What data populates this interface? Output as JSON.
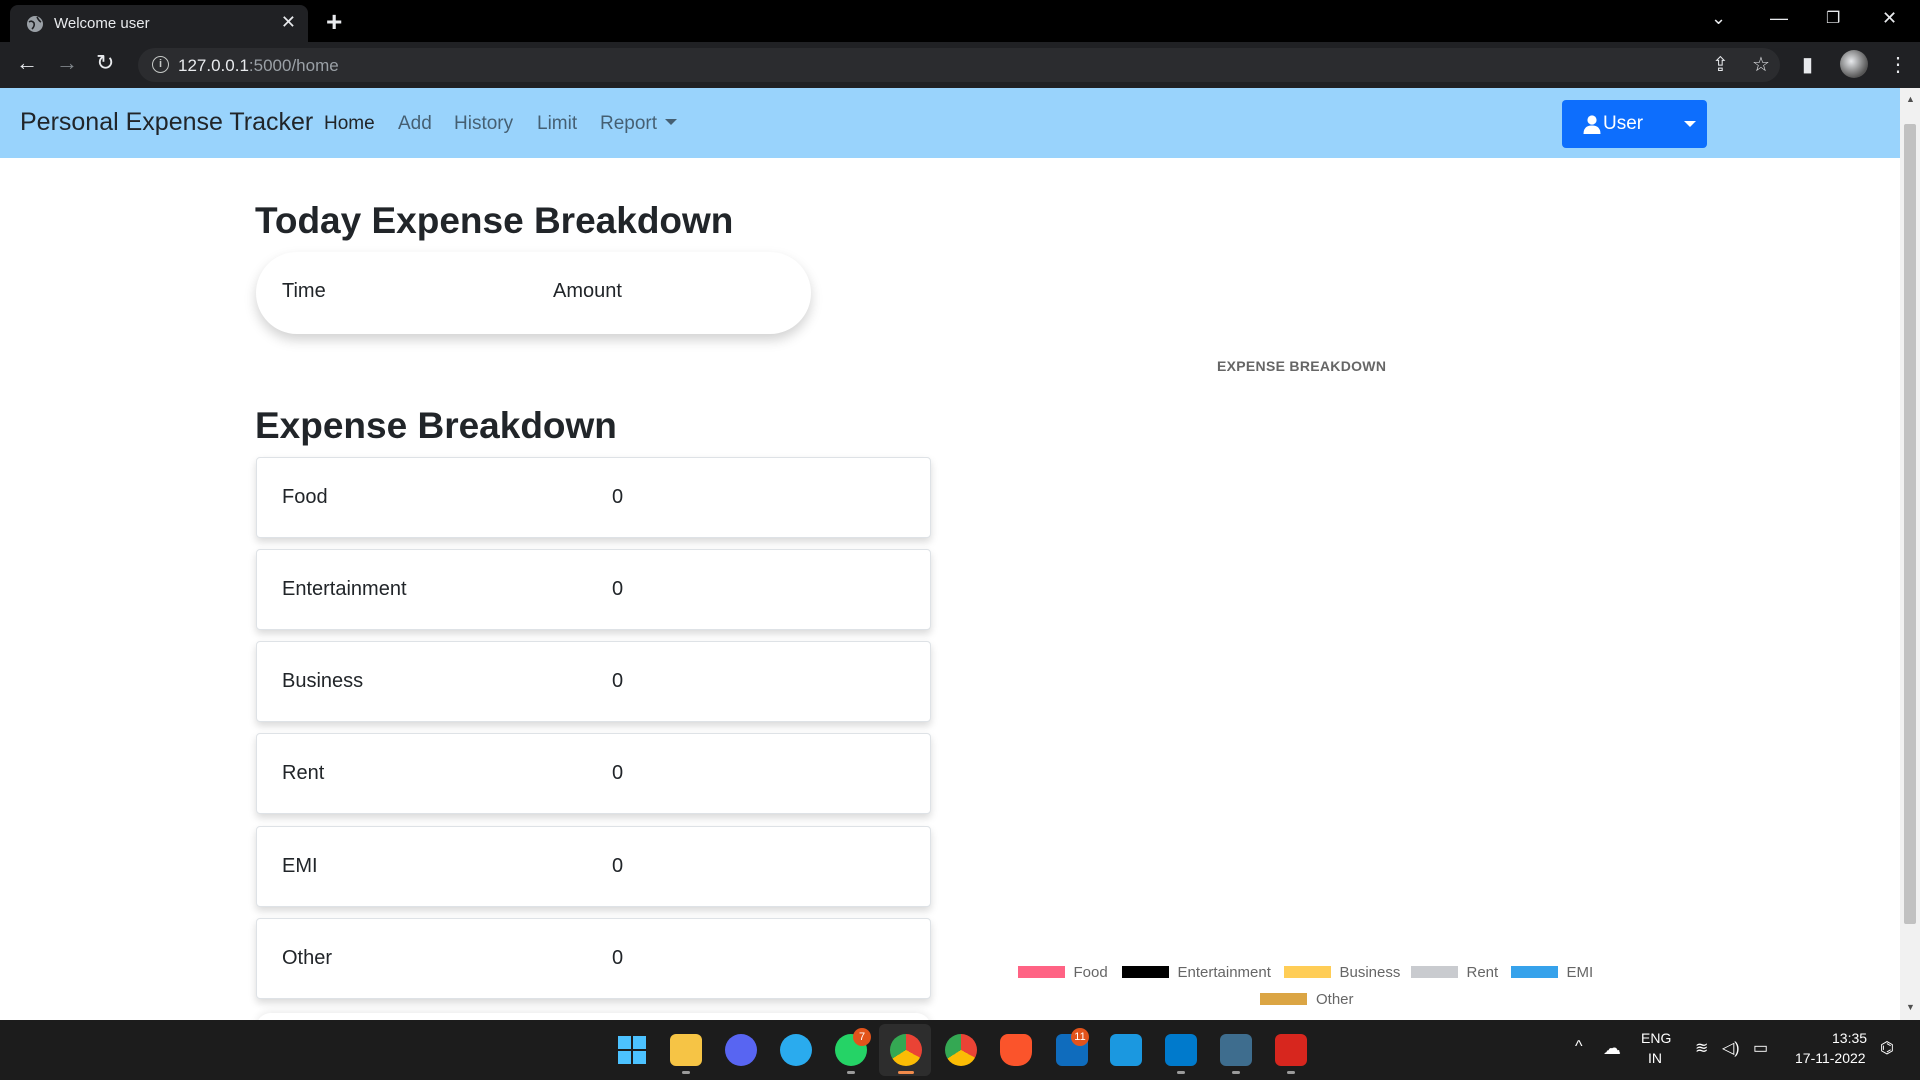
{
  "browser": {
    "tab_title": "Welcome user",
    "url_host": "127.0.0.1",
    "url_path": ":5000/home"
  },
  "navbar": {
    "brand": "Personal Expense Tracker",
    "links": [
      "Home",
      "Add",
      "History",
      "Limit",
      "Report"
    ],
    "user_label": "User"
  },
  "today": {
    "title": "Today Expense Breakdown",
    "col_time": "Time",
    "col_amount": "Amount"
  },
  "breakdown": {
    "title": "Expense Breakdown",
    "items": [
      {
        "category": "Food",
        "amount": "0"
      },
      {
        "category": "Entertainment",
        "amount": "0"
      },
      {
        "category": "Business",
        "amount": "0"
      },
      {
        "category": "Rent",
        "amount": "0"
      },
      {
        "category": "EMI",
        "amount": "0"
      },
      {
        "category": "Other",
        "amount": "0"
      }
    ]
  },
  "chart_data": {
    "type": "pie",
    "title": "EXPENSE BREAKDOWN",
    "categories": [
      "Food",
      "Entertainment",
      "Business",
      "Rent",
      "EMI",
      "Other"
    ],
    "values": [
      0,
      0,
      0,
      0,
      0,
      0
    ],
    "colors": [
      "#ff6384",
      "#000000",
      "#ffcd56",
      "#c9cbcf",
      "#36a2eb",
      "#dba544"
    ],
    "legend_position": "bottom"
  },
  "taskbar": {
    "lang": "ENG",
    "region": "IN",
    "time": "13:35",
    "date": "17-11-2022",
    "badges": {
      "whatsapp": "7",
      "mail": "11"
    }
  }
}
